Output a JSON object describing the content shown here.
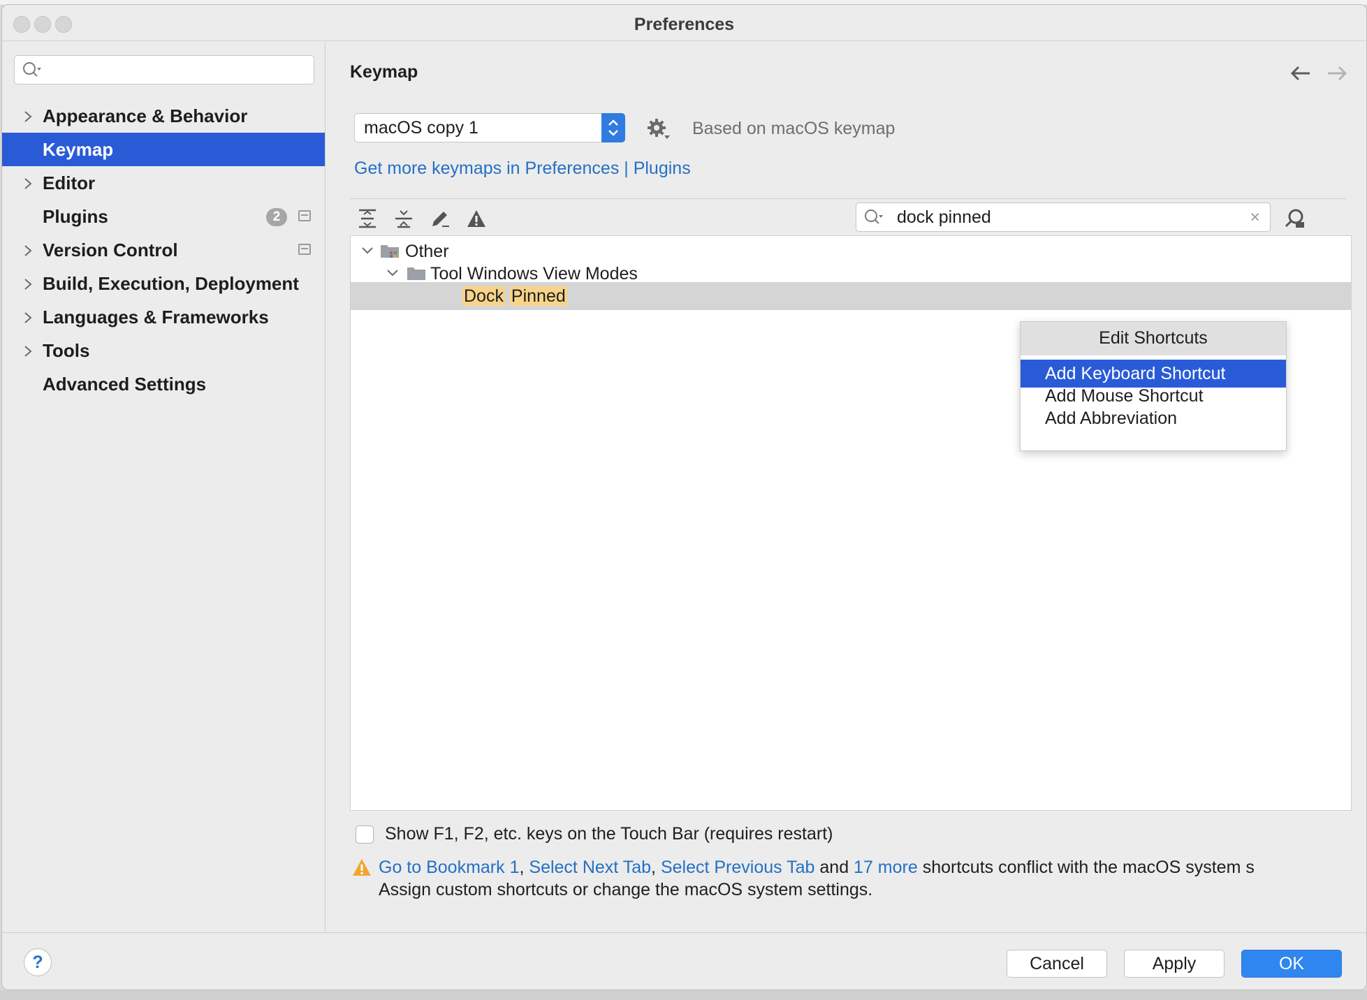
{
  "window": {
    "title": "Preferences"
  },
  "sidebar": {
    "search_placeholder": "",
    "items": [
      {
        "label": "Appearance & Behavior",
        "expandable": true
      },
      {
        "label": "Keymap",
        "expandable": false,
        "selected": true
      },
      {
        "label": "Editor",
        "expandable": true
      },
      {
        "label": "Plugins",
        "expandable": false,
        "badge": "2"
      },
      {
        "label": "Version Control",
        "expandable": true
      },
      {
        "label": "Build, Execution, Deployment",
        "expandable": true
      },
      {
        "label": "Languages & Frameworks",
        "expandable": true
      },
      {
        "label": "Tools",
        "expandable": true
      },
      {
        "label": "Advanced Settings",
        "expandable": false
      }
    ]
  },
  "main": {
    "title": "Keymap",
    "back_icon": "arrow-left-icon",
    "forward_icon": "arrow-right-icon",
    "keymap_select": {
      "value": "macOS copy 1"
    },
    "based_on": "Based on macOS keymap",
    "link": "Get more keymaps in Preferences | Plugins",
    "search": {
      "value": "dock pinned",
      "clear": "×"
    },
    "tree": {
      "group": "Other",
      "folder": "Tool Windows View Modes",
      "action": {
        "words": [
          "Dock",
          "Pinned"
        ]
      }
    },
    "context_menu": {
      "header": "Edit Shortcuts",
      "items": [
        {
          "label": "Add Keyboard Shortcut",
          "active": true
        },
        {
          "label": "Add Mouse Shortcut",
          "active": false
        },
        {
          "label": "Add Abbreviation",
          "active": false
        }
      ]
    },
    "touchbar_checkbox": {
      "label": "Show F1, F2, etc. keys on the Touch Bar (requires restart)",
      "checked": false
    },
    "conflict": {
      "link1": "Go to Bookmark 1",
      "sep1": ", ",
      "link2": "Select Next Tab",
      "sep2": ", ",
      "link3": "Select Previous Tab",
      "and": " and ",
      "link4": "17 more",
      "rest": " shortcuts conflict with the macOS system s",
      "line2": "Assign custom shortcuts or change the macOS system settings."
    }
  },
  "footer": {
    "help": "?",
    "cancel": "Cancel",
    "apply": "Apply",
    "ok": "OK"
  },
  "colors": {
    "accent": "#2a5bd7",
    "link": "#2470c4",
    "highlight": "#f7d48a",
    "primary_button": "#2f86ef"
  }
}
